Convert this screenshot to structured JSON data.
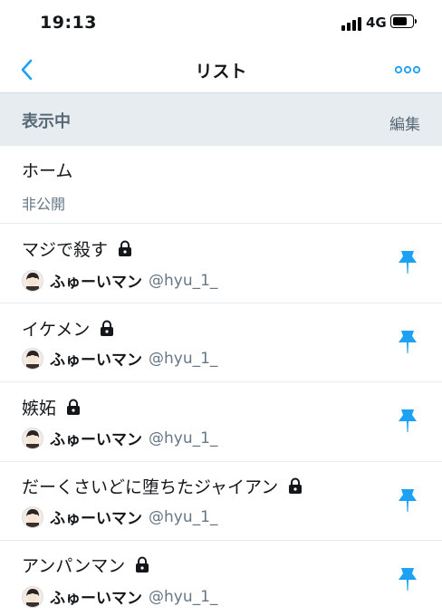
{
  "status_bar": {
    "time": "19:13",
    "network": "4G"
  },
  "nav": {
    "title": "リスト",
    "back_icon": "chevron-left-icon",
    "more_icon": "more-dots-icon"
  },
  "section": {
    "title": "表示中",
    "edit_label": "編集"
  },
  "home_row": {
    "title": "ホーム",
    "subtitle": "非公開"
  },
  "lists": [
    {
      "title": "マジで殺す",
      "owner_name": "ふゅーいマン",
      "owner_handle": "@hyu_1_",
      "private": true,
      "pinned": true
    },
    {
      "title": "イケメン",
      "owner_name": "ふゅーいマン",
      "owner_handle": "@hyu_1_",
      "private": true,
      "pinned": true
    },
    {
      "title": "嫉妬",
      "owner_name": "ふゅーいマン",
      "owner_handle": "@hyu_1_",
      "private": true,
      "pinned": true
    },
    {
      "title": "だーくさいどに堕ちたジャイアン",
      "owner_name": "ふゅーいマン",
      "owner_handle": "@hyu_1_",
      "private": true,
      "pinned": true
    },
    {
      "title": "アンパンマン",
      "owner_name": "ふゅーいマン",
      "owner_handle": "@hyu_1_",
      "private": true,
      "pinned": true
    }
  ],
  "colors": {
    "accent": "#1da1f2",
    "section_bg": "#e6ecf0",
    "muted_text": "#657786"
  }
}
